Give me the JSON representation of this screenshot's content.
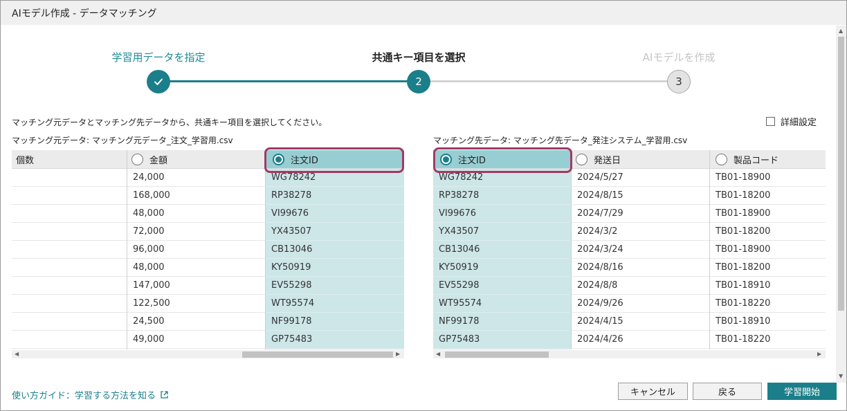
{
  "window": {
    "title": "AIモデル作成 - データマッチング"
  },
  "stepper": {
    "steps": [
      {
        "label": "学習用データを指定",
        "marker": "check-icon",
        "state": "done"
      },
      {
        "label": "共通キー項目を選択",
        "marker": "2",
        "state": "active"
      },
      {
        "label": "AIモデルを作成",
        "marker": "3",
        "state": "pending"
      }
    ]
  },
  "instruction": "マッチング元データとマッチング先データから、共通キー項目を選択してください。",
  "detail_setting": {
    "label": "詳細設定",
    "checked": false
  },
  "source_table": {
    "caption": "マッチング元データ: マッチング元データ_注文_学習用.csv",
    "columns": [
      {
        "header": "個数",
        "has_radio": false,
        "selected": false
      },
      {
        "header": "金額",
        "has_radio": true,
        "selected": false
      },
      {
        "header": "注文ID",
        "has_radio": true,
        "selected": true
      }
    ],
    "rows": [
      [
        "",
        "24,000",
        "WG78242"
      ],
      [
        "",
        "168,000",
        "RP38278"
      ],
      [
        "",
        "48,000",
        "VI99676"
      ],
      [
        "",
        "72,000",
        "YX43507"
      ],
      [
        "",
        "96,000",
        "CB13046"
      ],
      [
        "",
        "48,000",
        "KY50919"
      ],
      [
        "",
        "147,000",
        "EV55298"
      ],
      [
        "",
        "122,500",
        "WT95574"
      ],
      [
        "",
        "24,500",
        "NF99178"
      ],
      [
        "",
        "49,000",
        "GP75483"
      ]
    ]
  },
  "target_table": {
    "caption": "マッチング先データ: マッチング先データ_発注システム_学習用.csv",
    "columns": [
      {
        "header": "注文ID",
        "has_radio": true,
        "selected": true
      },
      {
        "header": "発送日",
        "has_radio": true,
        "selected": false
      },
      {
        "header": "製品コード",
        "has_radio": true,
        "selected": false
      }
    ],
    "rows": [
      [
        "WG78242",
        "2024/5/27",
        "TB01-18900"
      ],
      [
        "RP38278",
        "2024/8/15",
        "TB01-18200"
      ],
      [
        "VI99676",
        "2024/7/29",
        "TB01-18900"
      ],
      [
        "YX43507",
        "2024/3/2",
        "TB01-18200"
      ],
      [
        "CB13046",
        "2024/3/24",
        "TB01-18900"
      ],
      [
        "KY50919",
        "2024/8/16",
        "TB01-18200"
      ],
      [
        "EV55298",
        "2024/8/8",
        "TB01-18910"
      ],
      [
        "WT95574",
        "2024/9/26",
        "TB01-18220"
      ],
      [
        "NF99178",
        "2024/4/15",
        "TB01-18910"
      ],
      [
        "GP75483",
        "2024/4/26",
        "TB01-18220"
      ]
    ]
  },
  "guide_link": {
    "label": "使い方ガイド：学習する方法を知る",
    "icon": "external-link-icon"
  },
  "buttons": {
    "cancel": "キャンセル",
    "back": "戻る",
    "start": "学習開始"
  },
  "colors": {
    "accent": "#1a7f8a",
    "selected_column": "#cde6e8",
    "selected_header": "#97ced3",
    "highlight_border": "#a13a64"
  }
}
